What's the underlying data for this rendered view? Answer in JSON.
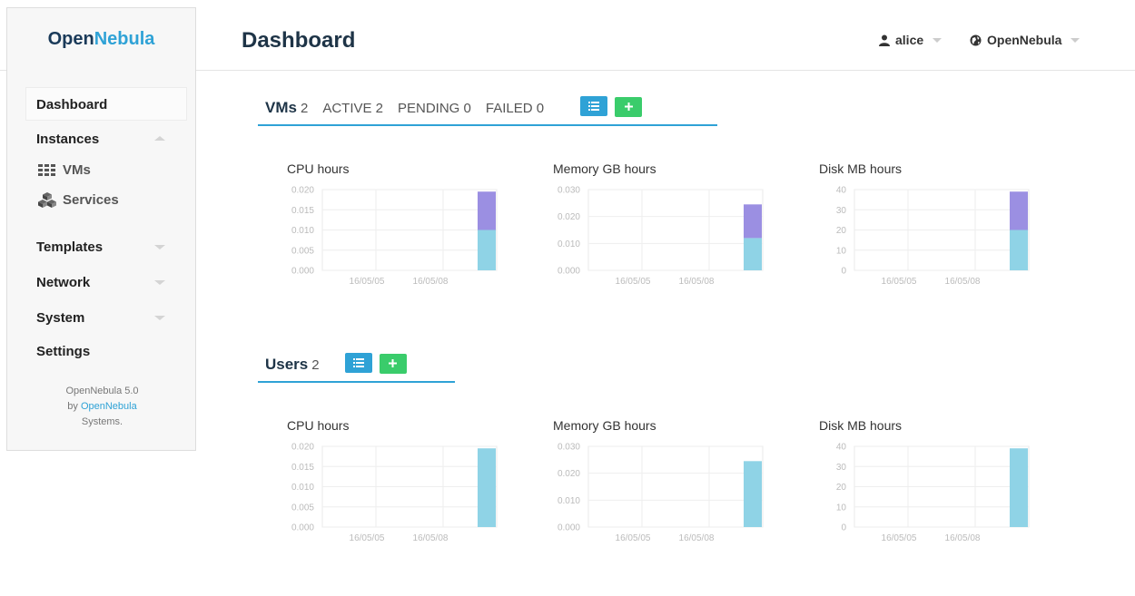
{
  "header": {
    "logo_part1": "Open",
    "logo_part2": "Nebula",
    "page_title": "Dashboard",
    "user_label": "alice",
    "zone_label": "OpenNebula"
  },
  "sidebar": {
    "items": {
      "dashboard": "Dashboard",
      "instances": "Instances",
      "vms": "VMs",
      "services": "Services",
      "templates": "Templates",
      "network": "Network",
      "system": "System",
      "settings": "Settings"
    },
    "footer": {
      "line1": "OpenNebula 5.0",
      "line2_prefix": "by ",
      "line2_link": "OpenNebula",
      "line3": "Systems."
    }
  },
  "vms_section": {
    "title": "VMs",
    "count": "2",
    "active": "ACTIVE 2",
    "pending": "PENDING 0",
    "failed": "FAILED 0"
  },
  "users_section": {
    "title": "Users",
    "count": "2"
  },
  "colors": {
    "accent": "#2fa2d6",
    "add_button": "#3acc6b",
    "series_1": "#8fd3e6",
    "series_2": "#9b8fe2"
  },
  "chart_data": [
    {
      "type": "bar",
      "title": "CPU hours",
      "x_ticks": [
        "16/05/05",
        "16/05/08"
      ],
      "y_ticks": [
        "0.020",
        "0.015",
        "0.010",
        "0.005",
        "0.000"
      ],
      "ylim": [
        0,
        0.02
      ],
      "stacked": true,
      "series": [
        {
          "values": [
            0.01
          ]
        },
        {
          "values": [
            0.0095
          ]
        }
      ]
    },
    {
      "type": "bar",
      "title": "Memory GB hours",
      "x_ticks": [
        "16/05/05",
        "16/05/08"
      ],
      "y_ticks": [
        "0.030",
        "0.020",
        "0.010",
        "0.000"
      ],
      "ylim": [
        0,
        0.03
      ],
      "stacked": true,
      "series": [
        {
          "values": [
            0.012
          ]
        },
        {
          "values": [
            0.0125
          ]
        }
      ]
    },
    {
      "type": "bar",
      "title": "Disk MB hours",
      "x_ticks": [
        "16/05/05",
        "16/05/08"
      ],
      "y_ticks": [
        "40",
        "30",
        "20",
        "10",
        "0"
      ],
      "ylim": [
        0,
        40
      ],
      "stacked": true,
      "series": [
        {
          "values": [
            20
          ]
        },
        {
          "values": [
            19
          ]
        }
      ]
    },
    {
      "type": "bar",
      "title": "CPU hours",
      "x_ticks": [
        "16/05/05",
        "16/05/08"
      ],
      "y_ticks": [
        "0.020",
        "0.015",
        "0.010",
        "0.005",
        "0.000"
      ],
      "ylim": [
        0,
        0.02
      ],
      "stacked": true,
      "series": [
        {
          "values": [
            0.0195
          ]
        }
      ]
    },
    {
      "type": "bar",
      "title": "Memory GB hours",
      "x_ticks": [
        "16/05/05",
        "16/05/08"
      ],
      "y_ticks": [
        "0.030",
        "0.020",
        "0.010",
        "0.000"
      ],
      "ylim": [
        0,
        0.03
      ],
      "stacked": true,
      "series": [
        {
          "values": [
            0.0245
          ]
        }
      ]
    },
    {
      "type": "bar",
      "title": "Disk MB hours",
      "x_ticks": [
        "16/05/05",
        "16/05/08"
      ],
      "y_ticks": [
        "40",
        "30",
        "20",
        "10",
        "0"
      ],
      "ylim": [
        0,
        40
      ],
      "stacked": true,
      "series": [
        {
          "values": [
            39
          ]
        }
      ]
    }
  ]
}
